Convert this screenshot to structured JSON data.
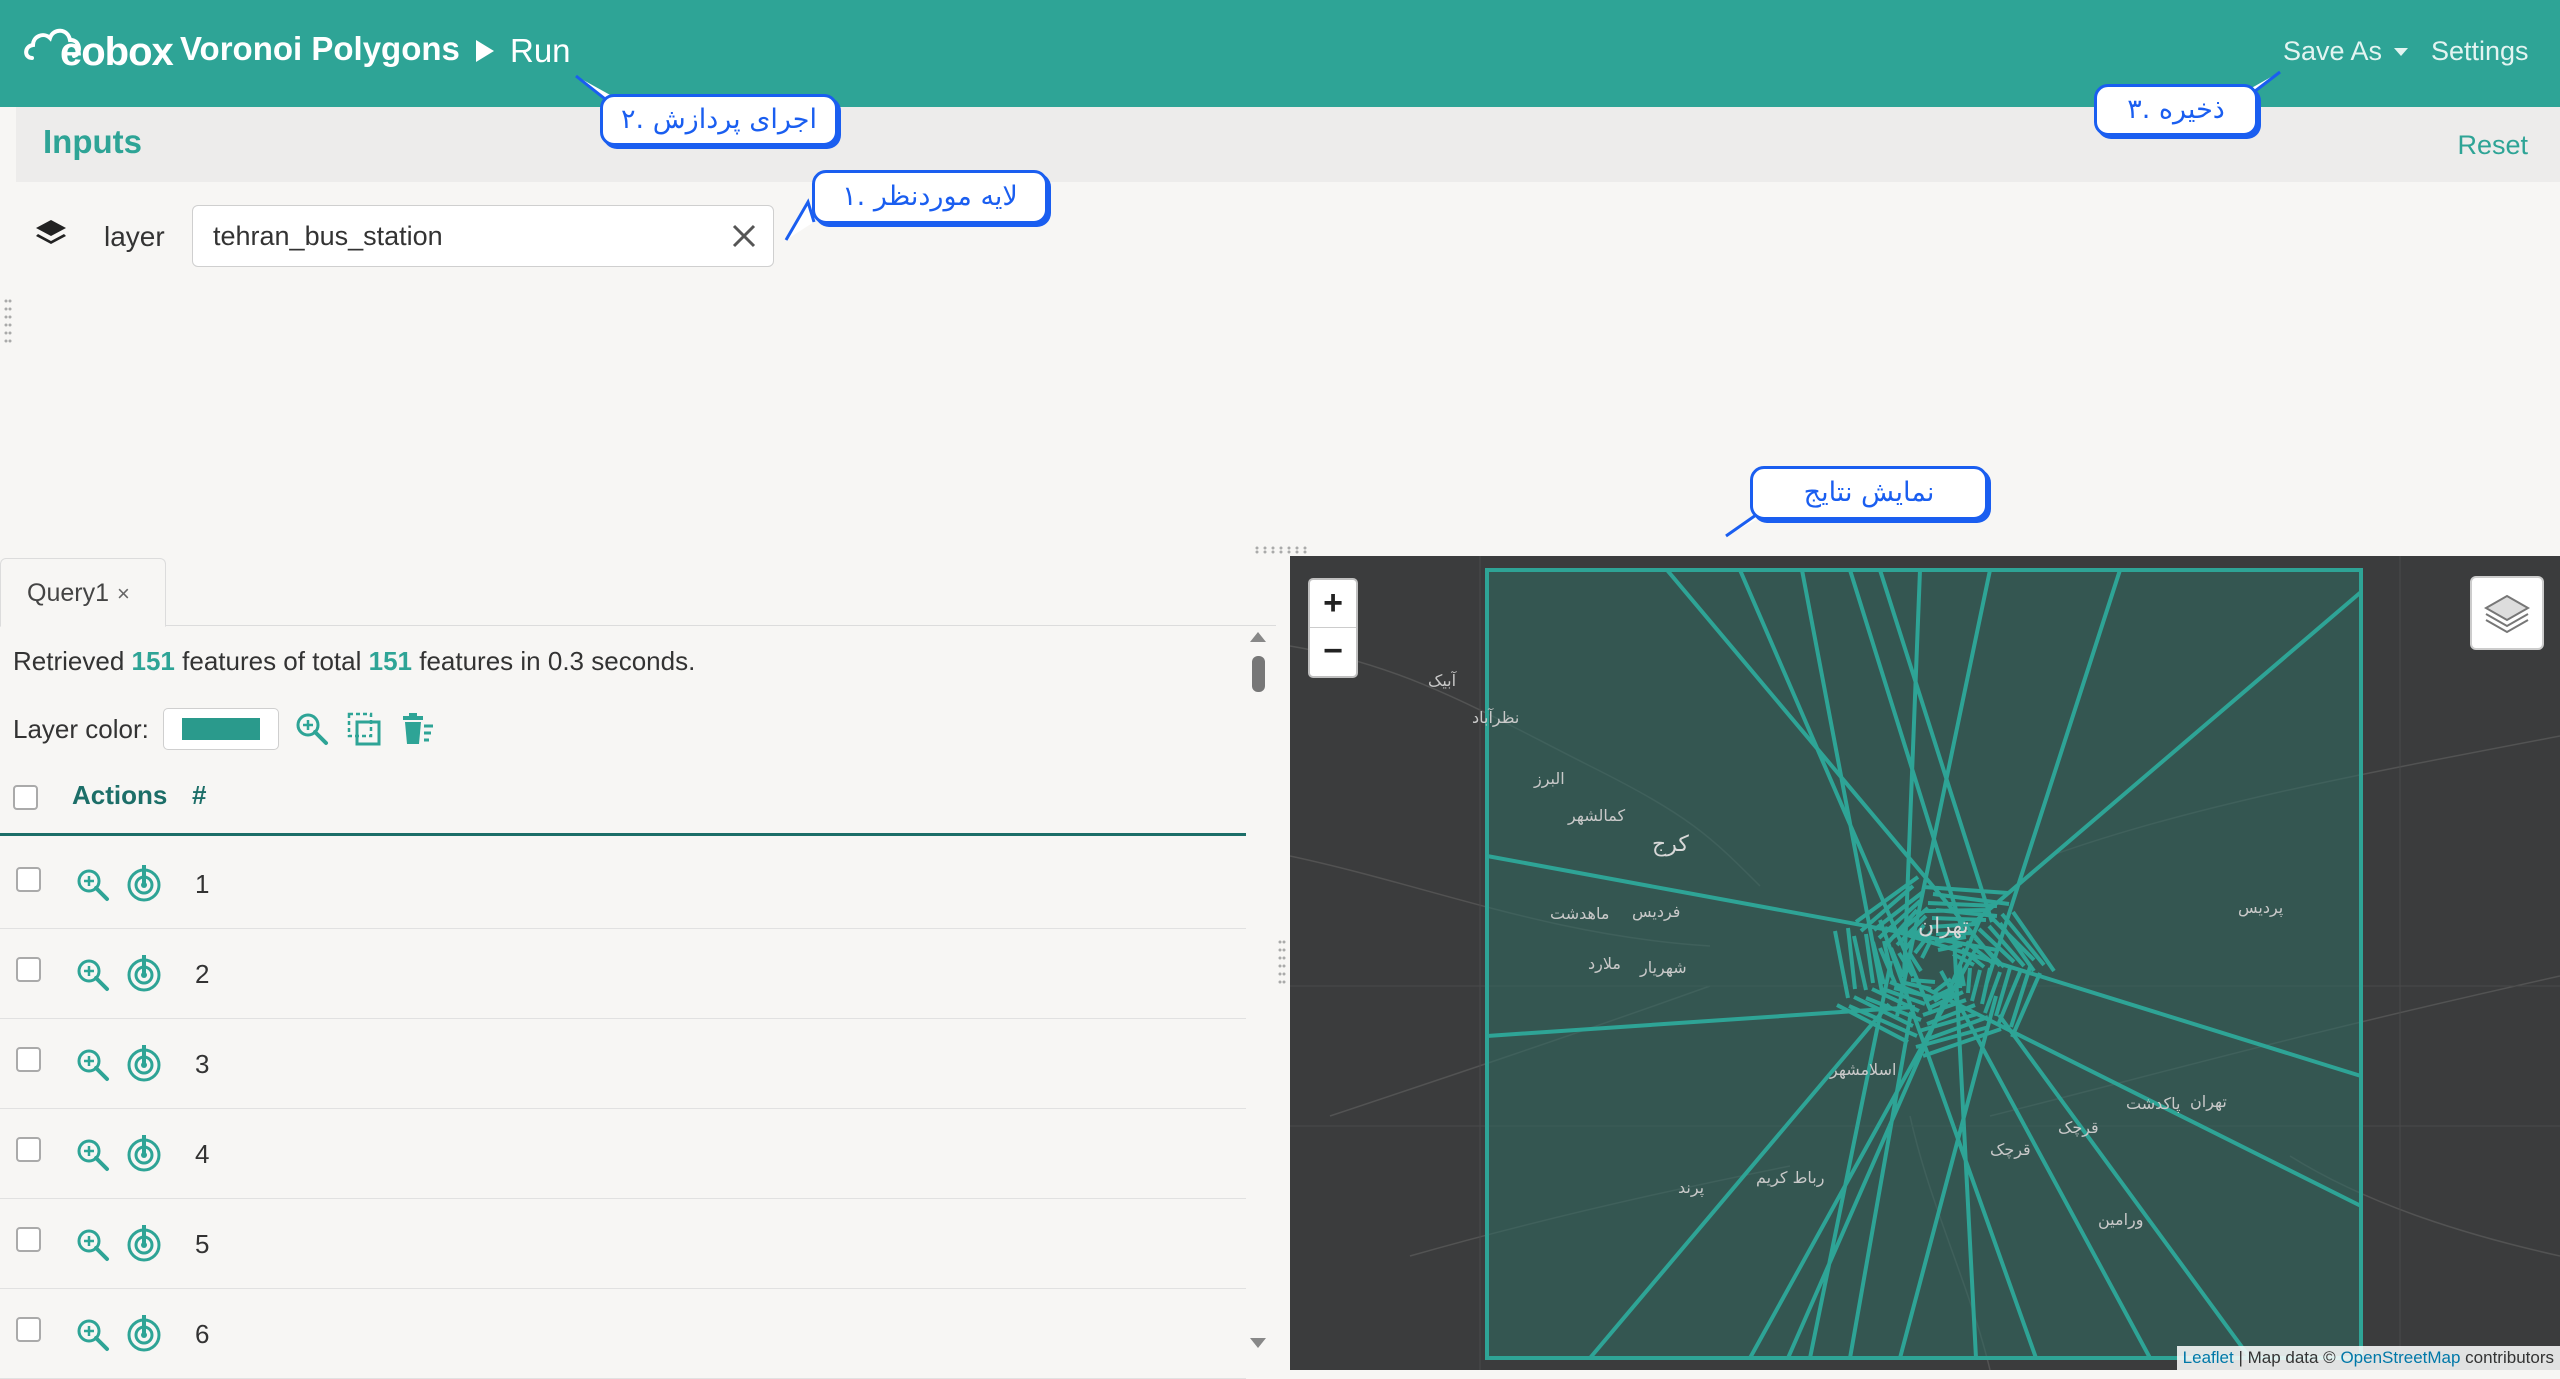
{
  "header": {
    "logo_text": "eobox",
    "app_title": "Voronoi Polygons",
    "run_label": "Run",
    "save_as_label": "Save As",
    "settings_label": "Settings"
  },
  "inputs": {
    "title": "Inputs",
    "reset_label": "Reset",
    "layer_label": "layer",
    "layer_value": "tehran_bus_station"
  },
  "query": {
    "tab_label": "Query1",
    "tab_close": "×",
    "retrieved_prefix": "Retrieved",
    "retrieved_count": "151",
    "retrieved_mid": "features of total",
    "total_count": "151",
    "retrieved_suffix": "features in 0.3 seconds.",
    "layer_color_label": "Layer color:",
    "layer_color": "#2a9a8c",
    "columns": {
      "actions": "Actions",
      "num": "#"
    },
    "rows": [
      "1",
      "2",
      "3",
      "4",
      "5",
      "6"
    ]
  },
  "map": {
    "zoom_in": "+",
    "zoom_out": "−",
    "attribution": {
      "leaflet": "Leaflet",
      "mid": " | Map data © ",
      "osm": "OpenStreetMap",
      "suffix": " contributors"
    },
    "labels": [
      "آبیک",
      "نظرآباد",
      "البرز",
      "کمالشهر",
      "کرج",
      "ماهدشت",
      "فردیس",
      "شهریار",
      "ملارد",
      "تهران",
      "پردیس",
      "تهران",
      "پاکدشت",
      "قرچک",
      "ورامین",
      "پرند",
      "رباط کریم",
      "اسلامشهر",
      "قرچک"
    ],
    "polygon_color": "#2ea496"
  },
  "callouts": {
    "layer": "۱. لایه موردنظر",
    "run": "۲. اجرای پردازش",
    "save": "۳. ذخیره",
    "results": "نمایش نتایج"
  },
  "icons": {
    "layers": "layers-icon",
    "clear": "close-icon",
    "zoom": "zoom-in-icon",
    "target": "locate-icon",
    "select": "select-icon",
    "delete": "delete-icon"
  }
}
